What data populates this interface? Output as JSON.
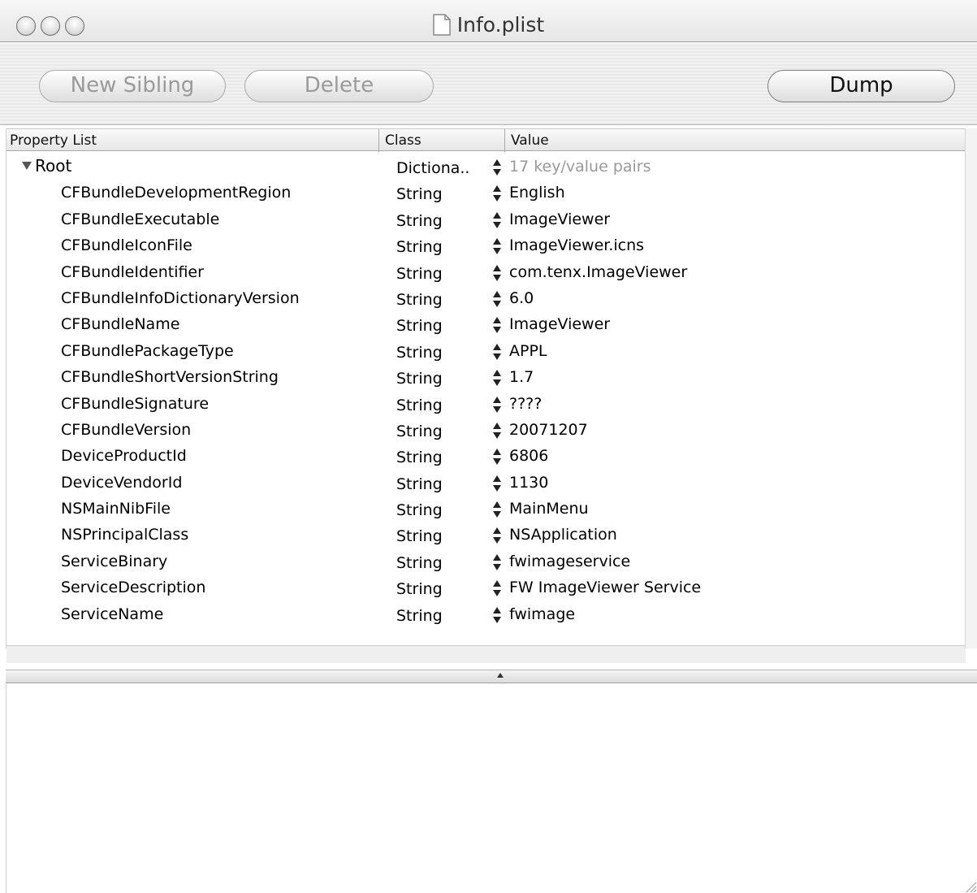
{
  "window": {
    "title": "Info.plist"
  },
  "toolbar": {
    "new_sibling_label": "New Sibling",
    "delete_label": "Delete",
    "dump_label": "Dump"
  },
  "columns": {
    "property_list": "Property List",
    "class": "Class",
    "value": "Value"
  },
  "root": {
    "key": "Root",
    "class": "Dictiona..",
    "value": "17 key/value pairs"
  },
  "rows": [
    {
      "key": "CFBundleDevelopmentRegion",
      "class": "String",
      "value": "English"
    },
    {
      "key": "CFBundleExecutable",
      "class": "String",
      "value": "ImageViewer"
    },
    {
      "key": "CFBundleIconFile",
      "class": "String",
      "value": "ImageViewer.icns"
    },
    {
      "key": "CFBundleIdentifier",
      "class": "String",
      "value": "com.tenx.ImageViewer"
    },
    {
      "key": "CFBundleInfoDictionaryVersion",
      "class": "String",
      "value": "6.0"
    },
    {
      "key": "CFBundleName",
      "class": "String",
      "value": "ImageViewer"
    },
    {
      "key": "CFBundlePackageType",
      "class": "String",
      "value": "APPL"
    },
    {
      "key": "CFBundleShortVersionString",
      "class": "String",
      "value": "1.7"
    },
    {
      "key": "CFBundleSignature",
      "class": "String",
      "value": "????"
    },
    {
      "key": "CFBundleVersion",
      "class": "String",
      "value": "20071207"
    },
    {
      "key": "DeviceProductId",
      "class": "String",
      "value": "6806"
    },
    {
      "key": "DeviceVendorId",
      "class": "String",
      "value": "1130"
    },
    {
      "key": "NSMainNibFile",
      "class": "String",
      "value": "MainMenu"
    },
    {
      "key": "NSPrincipalClass",
      "class": "String",
      "value": "NSApplication"
    },
    {
      "key": "ServiceBinary",
      "class": "String",
      "value": "fwimageservice"
    },
    {
      "key": "ServiceDescription",
      "class": "String",
      "value": "FW ImageViewer Service"
    },
    {
      "key": "ServiceName",
      "class": "String",
      "value": "fwimage"
    }
  ],
  "dump_text": ""
}
